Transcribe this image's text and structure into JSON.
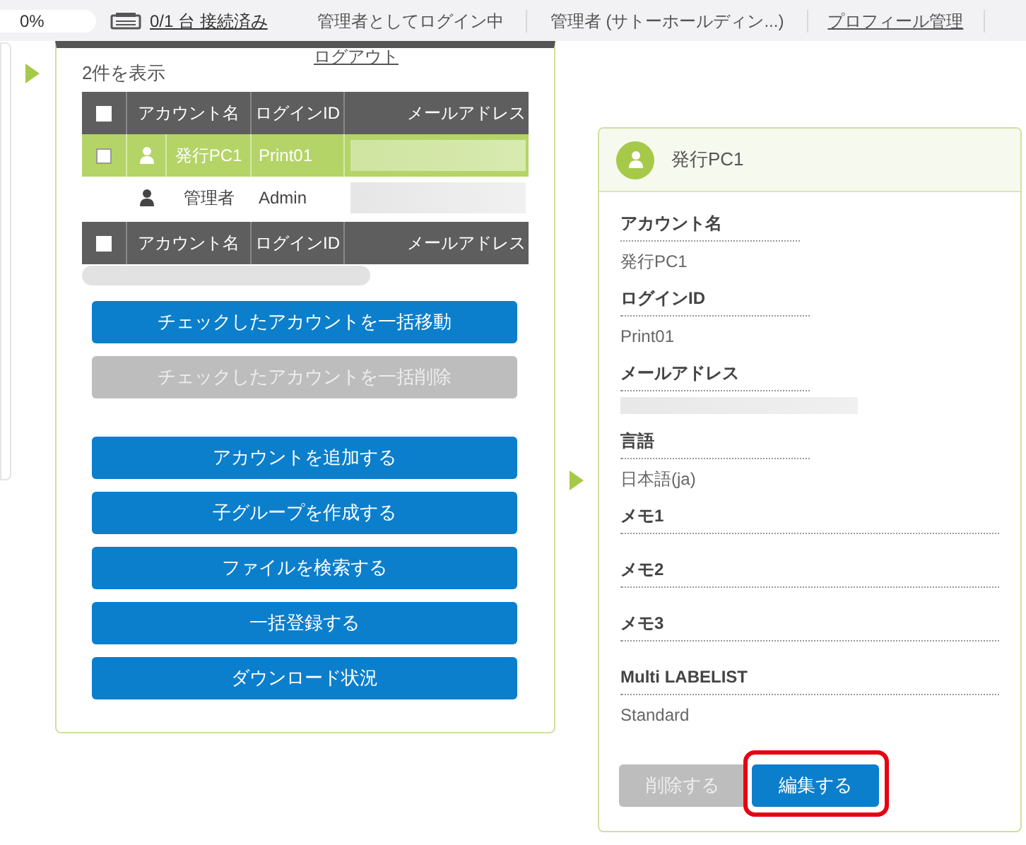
{
  "top_bar": {
    "progress": "0%",
    "connection": "0/1 台 接続済み",
    "login_status": "管理者としてログイン中",
    "user": "管理者 (サトーホールディン...)",
    "profile_link": "プロフィール管理",
    "logout_link": "ログアウト"
  },
  "account_list": {
    "count": "2件を表示",
    "columns": [
      "アカウント名",
      "ログインID",
      "メールアドレス"
    ],
    "header_checked": false,
    "rows": [
      {
        "name": "発行PC1",
        "login_id": "Print01",
        "selected": true,
        "checked": false
      },
      {
        "name": "管理者",
        "login_id": "Admin",
        "selected": false
      }
    ],
    "footer_columns": [
      "アカウント名",
      "ログインID",
      "メールアドレス"
    ],
    "footer_checked": false,
    "buttons": [
      {
        "label": "チェックしたアカウントを一括移動",
        "disabled": false
      },
      {
        "label": "チェックしたアカウントを一括削除",
        "disabled": true
      },
      {
        "label": "アカウントを追加する",
        "disabled": false
      },
      {
        "label": "子グループを作成する",
        "disabled": false
      },
      {
        "label": "ファイルを検索する",
        "disabled": false
      },
      {
        "label": "一括登録する",
        "disabled": false
      },
      {
        "label": "ダウンロード状況",
        "disabled": false
      }
    ]
  },
  "detail": {
    "title": "発行PC1",
    "fields": [
      {
        "label": "アカウント名",
        "value": "発行PC1",
        "kind": "short"
      },
      {
        "label": "ログインID",
        "value": "Print01",
        "kind": "short"
      },
      {
        "label": "メールアドレス",
        "kind": "blurred"
      },
      {
        "label": "言語",
        "value": "日本語(ja)",
        "kind": "short"
      },
      {
        "label": "メモ1",
        "kind": "wide"
      },
      {
        "label": "メモ2",
        "kind": "wide"
      },
      {
        "label": "メモ3",
        "kind": "wide"
      },
      {
        "label": "Multi LABELIST",
        "value": "Standard",
        "kind": "wide"
      }
    ],
    "buttons": [
      {
        "label": "削除する",
        "disabled": true,
        "highlighted": false
      },
      {
        "label": "編集する",
        "disabled": false,
        "highlighted": true
      }
    ]
  }
}
